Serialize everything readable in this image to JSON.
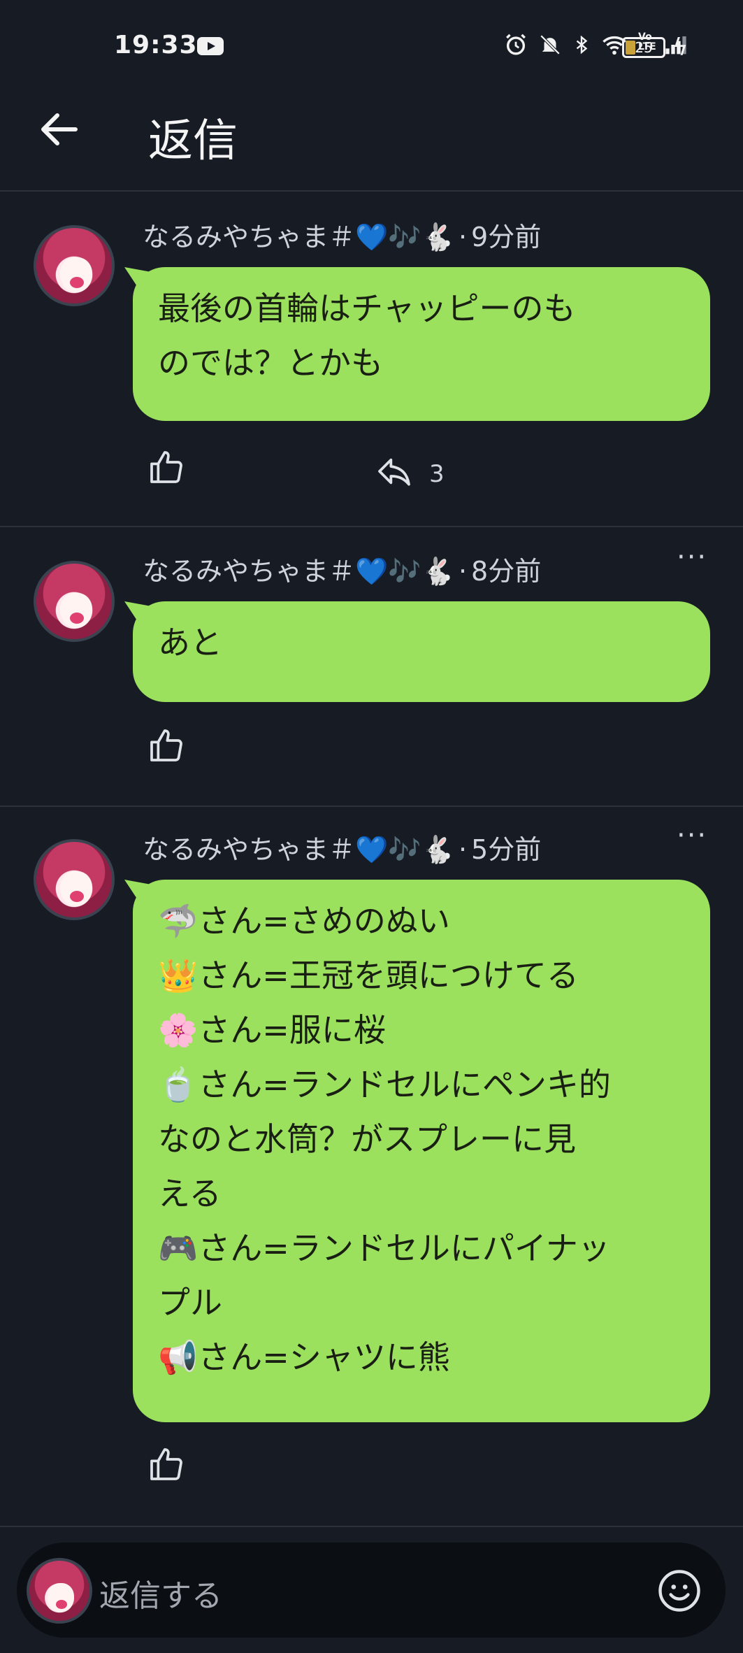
{
  "status_bar": {
    "time": "19:33",
    "battery": "25",
    "icons": [
      "youtube-icon",
      "alarm-icon",
      "mute-icon",
      "bluetooth-icon",
      "wifi-icon",
      "volte-icon",
      "signal-icon",
      "battery-icon",
      "charging-icon"
    ],
    "volte_label": "Vo LTE"
  },
  "header": {
    "title": "返信",
    "back_icon": "arrow-left-icon"
  },
  "replies": [
    {
      "author": "なるみやちゃま＃💙🎶🐇",
      "time": "9分前",
      "text": "最後の首輪はチャッピーのも\nのでは？とかも",
      "reply_count": "3",
      "has_more": false
    },
    {
      "author": "なるみやちゃま＃💙🎶🐇",
      "time": "8分前",
      "text": "あと",
      "reply_count": "",
      "has_more": true
    },
    {
      "author": "なるみやちゃま＃💙🎶🐇",
      "time": "5分前",
      "text": "🦈さん=さめのぬい\n👑さん=王冠を頭につけてる\n🌸さん=服に桜\n🍵さん=ランドセルにペンキ的\nなのと水筒？がスプレーに見\nえる\n🎮さん=ランドセルにパイナッ\nプル\n📢さん=シャツに熊",
      "reply_count": "",
      "has_more": true
    }
  ],
  "composer": {
    "placeholder": "返信する",
    "emoji_icon": "smiley-icon"
  },
  "colors": {
    "background": "#161b24",
    "bubble": "#9be15d",
    "text": "#e6e8ec"
  }
}
